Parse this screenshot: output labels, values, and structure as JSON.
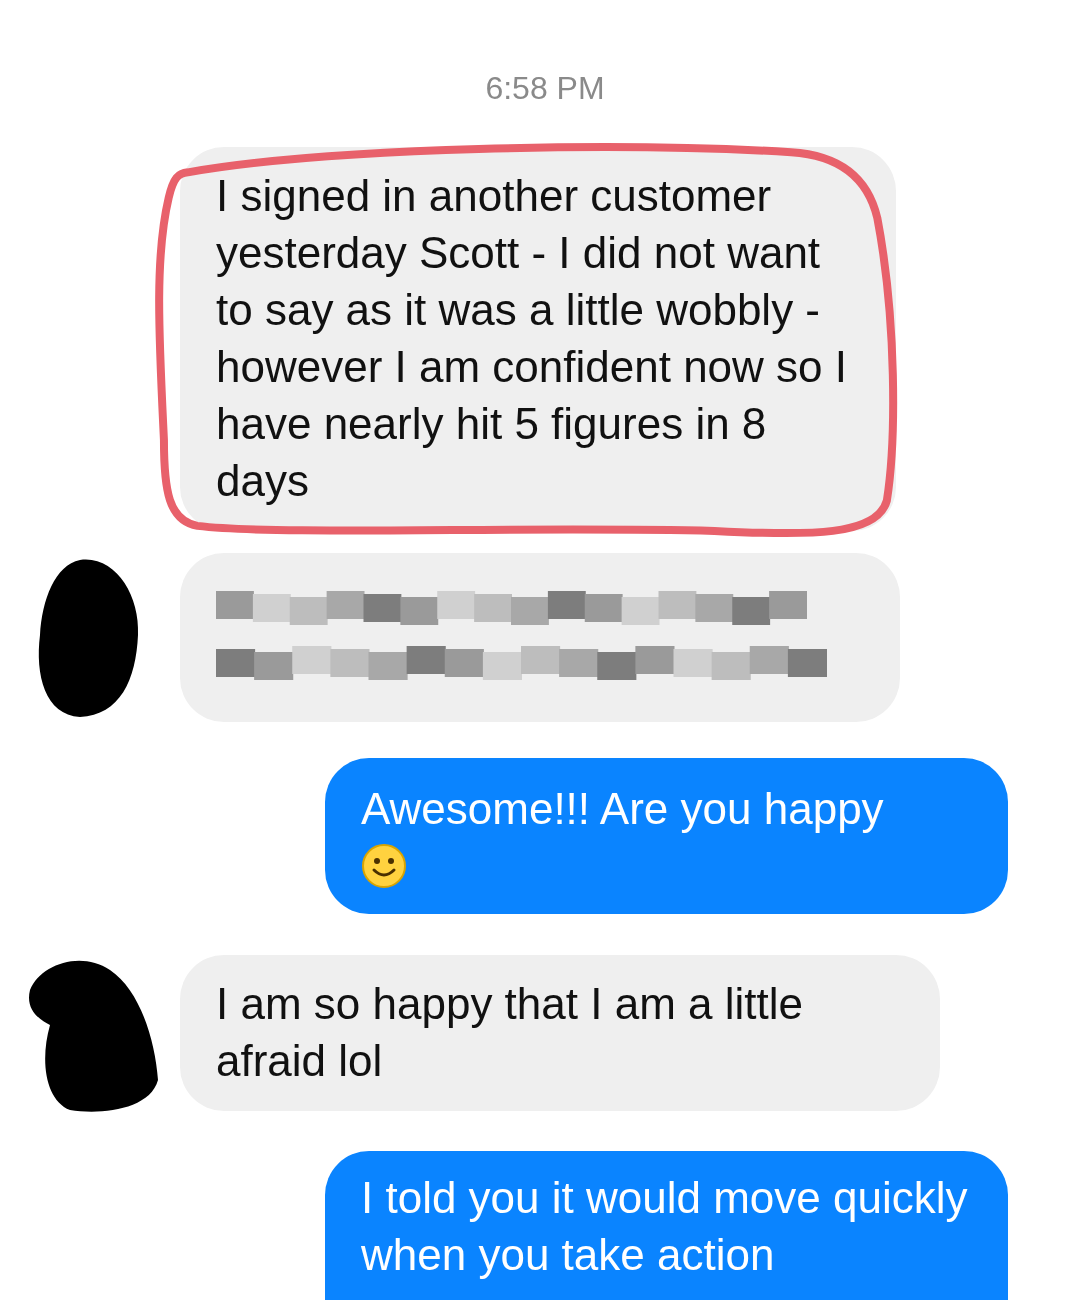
{
  "timestamp": "6:58 PM",
  "messages": [
    {
      "kind": "incoming",
      "text": "I signed in another customer yesterday Scott - I did not want to say as it was a little wobbly - however I am confident now so I have nearly hit 5 figures in 8 days",
      "highlighted": true,
      "avatar": false
    },
    {
      "kind": "redacted",
      "avatar": true
    },
    {
      "kind": "outgoing",
      "text": "Awesome!!! Are you happy",
      "emoji": true
    },
    {
      "kind": "incoming",
      "text": "I am so happy that I am a little afraid lol",
      "highlighted": false,
      "avatar": true
    },
    {
      "kind": "outgoing",
      "text": "I told you it would move quickly when you take action",
      "emoji": false
    }
  ]
}
